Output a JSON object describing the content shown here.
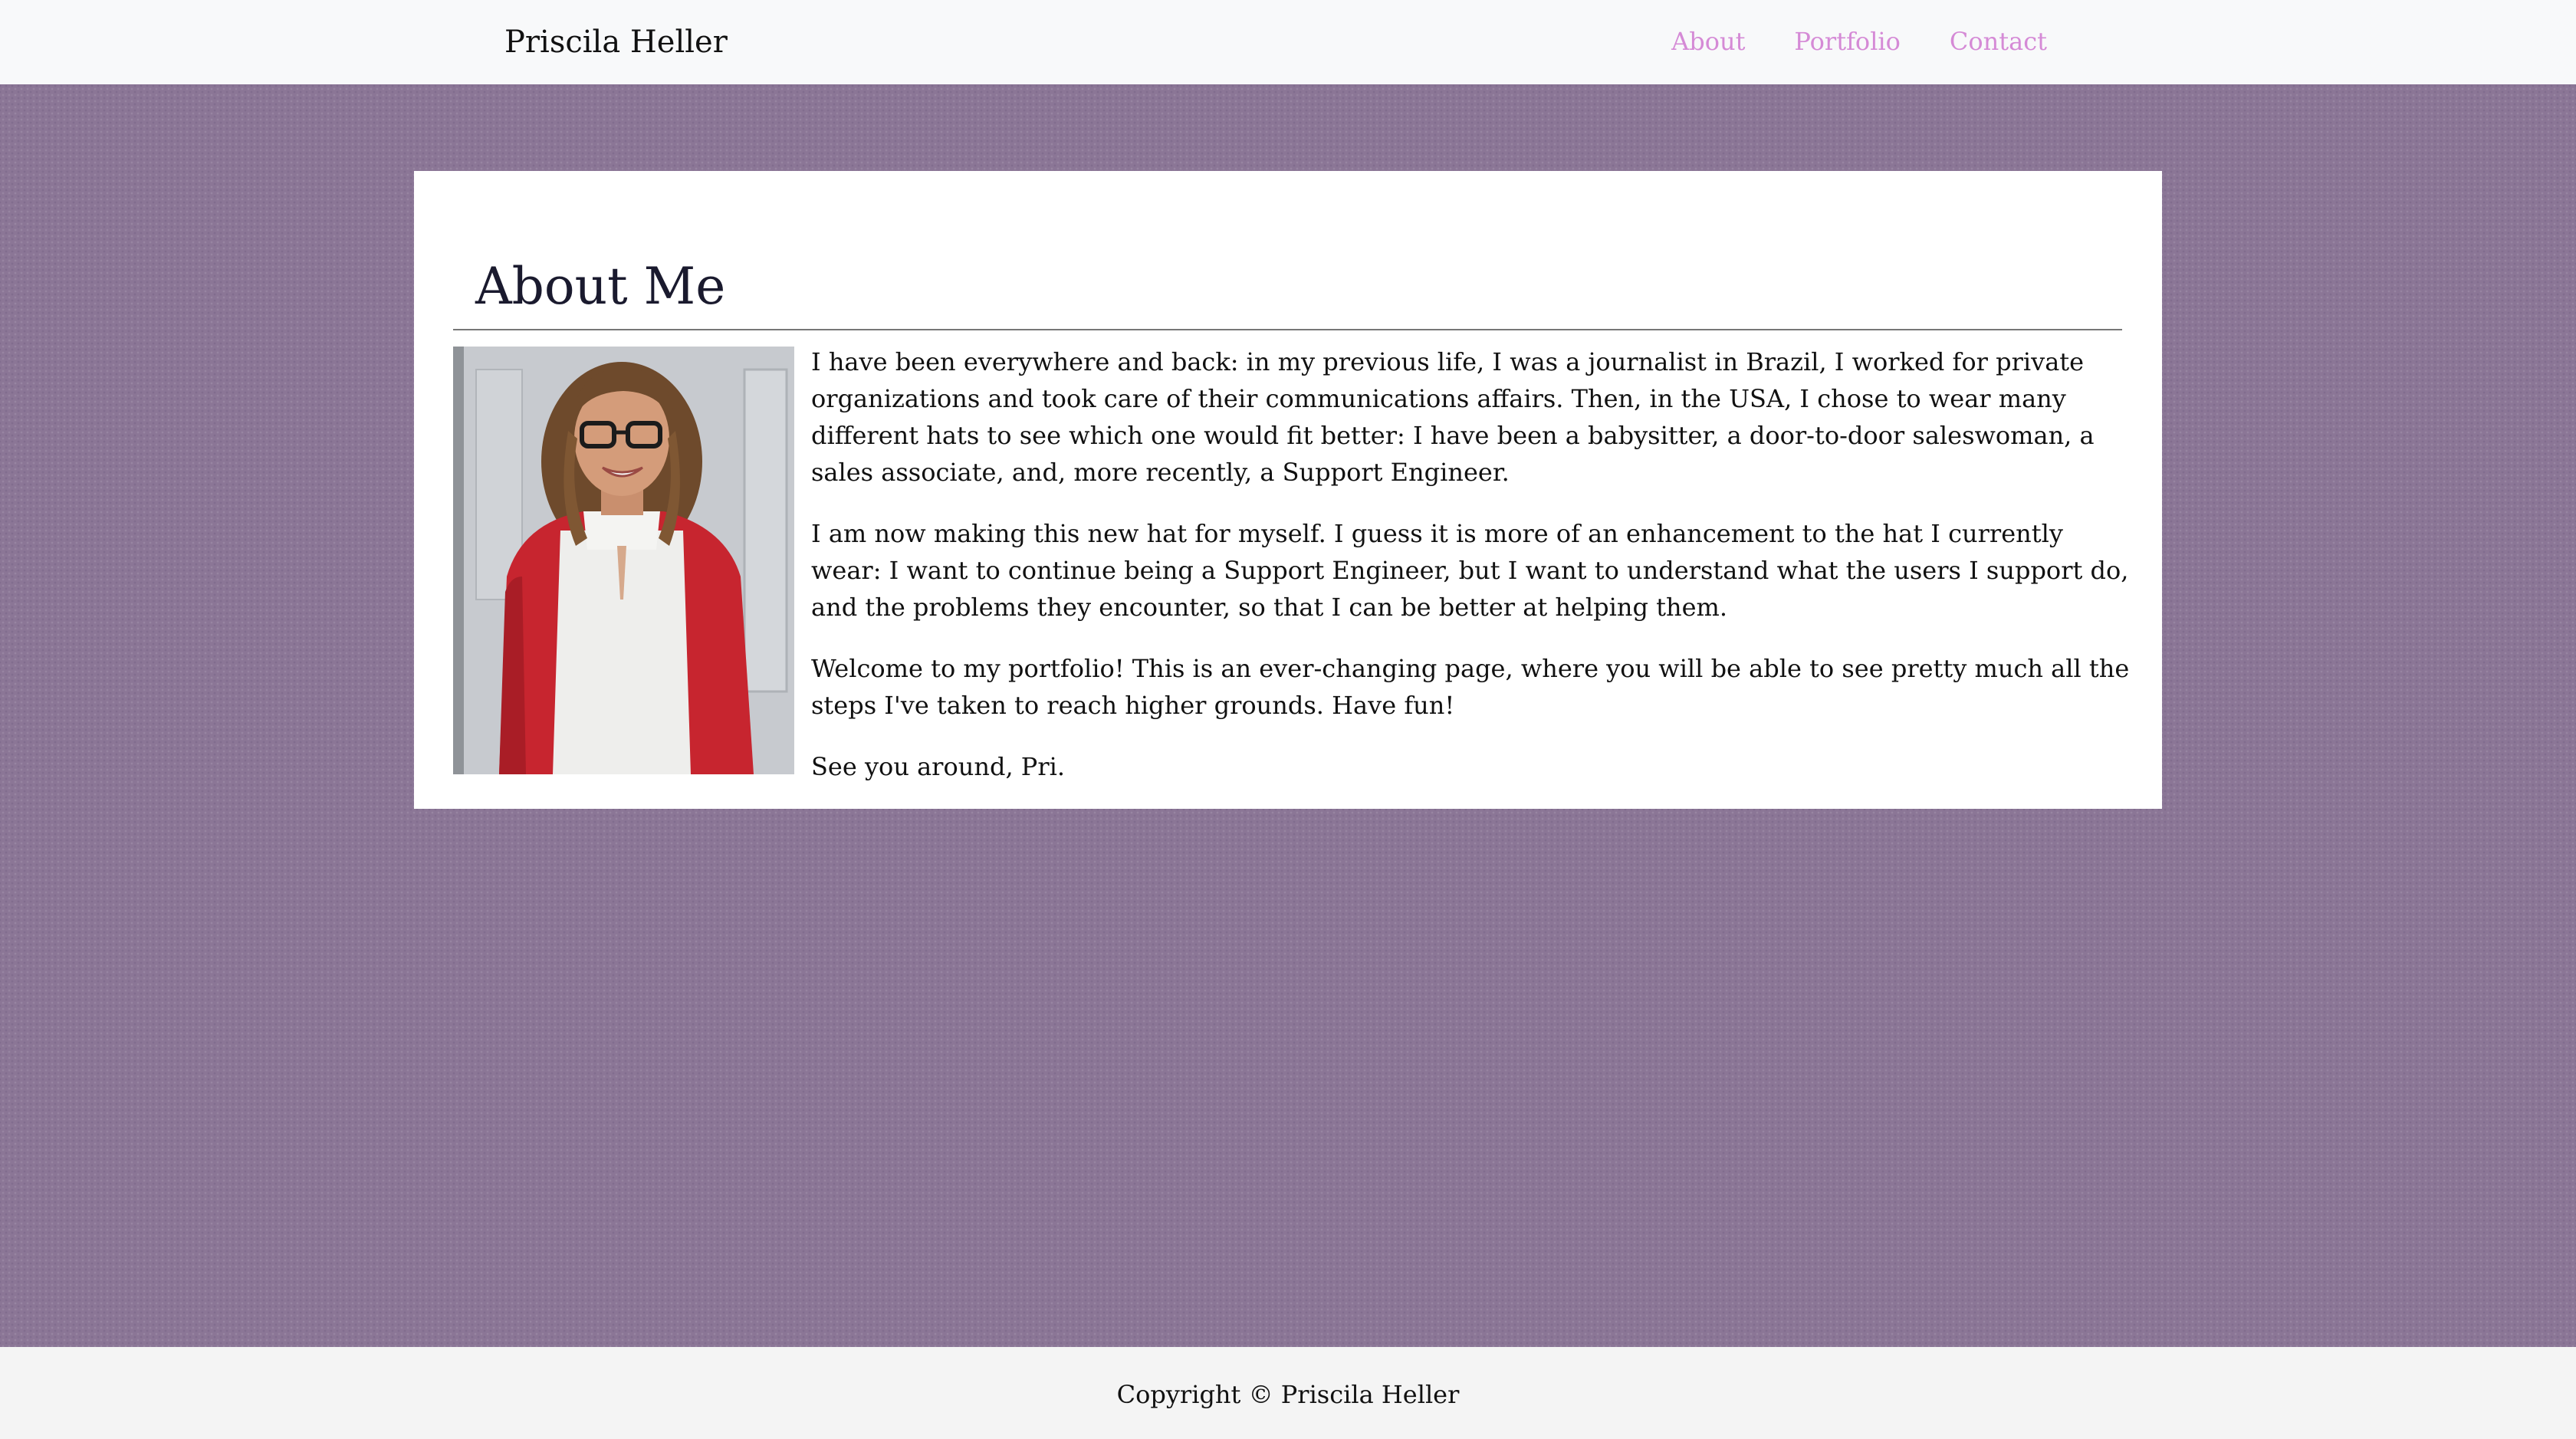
{
  "nav": {
    "brand": "Priscila Heller",
    "links": [
      {
        "label": "About"
      },
      {
        "label": "Portfolio"
      },
      {
        "label": "Contact"
      }
    ]
  },
  "about": {
    "title": "About Me",
    "photo_icon": "portrait-photo",
    "paragraphs": [
      "I have been everywhere and back: in my previous life, I was a journalist in Brazil, I worked for private organizations and took care of their communications affairs. Then, in the USA, I chose to wear many different hats to see which one would fit better: I have been a babysitter, a door-to-door saleswoman, a sales associate, and, more recently, a Support Engineer.",
      "I am now making this new hat for myself. I guess it is more of an enhancement to the hat I currently wear: I want to continue being a Support Engineer, but I want to understand what the users I support do, and the problems they encounter, so that I can be better at helping them.",
      "Welcome to my portfolio! This is an ever-changing page, where you will be able to see pretty much all the steps I've taken to reach higher grounds. Have fun!",
      "See you around, Pri."
    ]
  },
  "footer": {
    "copyright": "Copyright © Priscila Heller"
  },
  "colors": {
    "page_background": "#8b7696",
    "nav_link": "#d58ad6",
    "card_background": "#ffffff"
  }
}
